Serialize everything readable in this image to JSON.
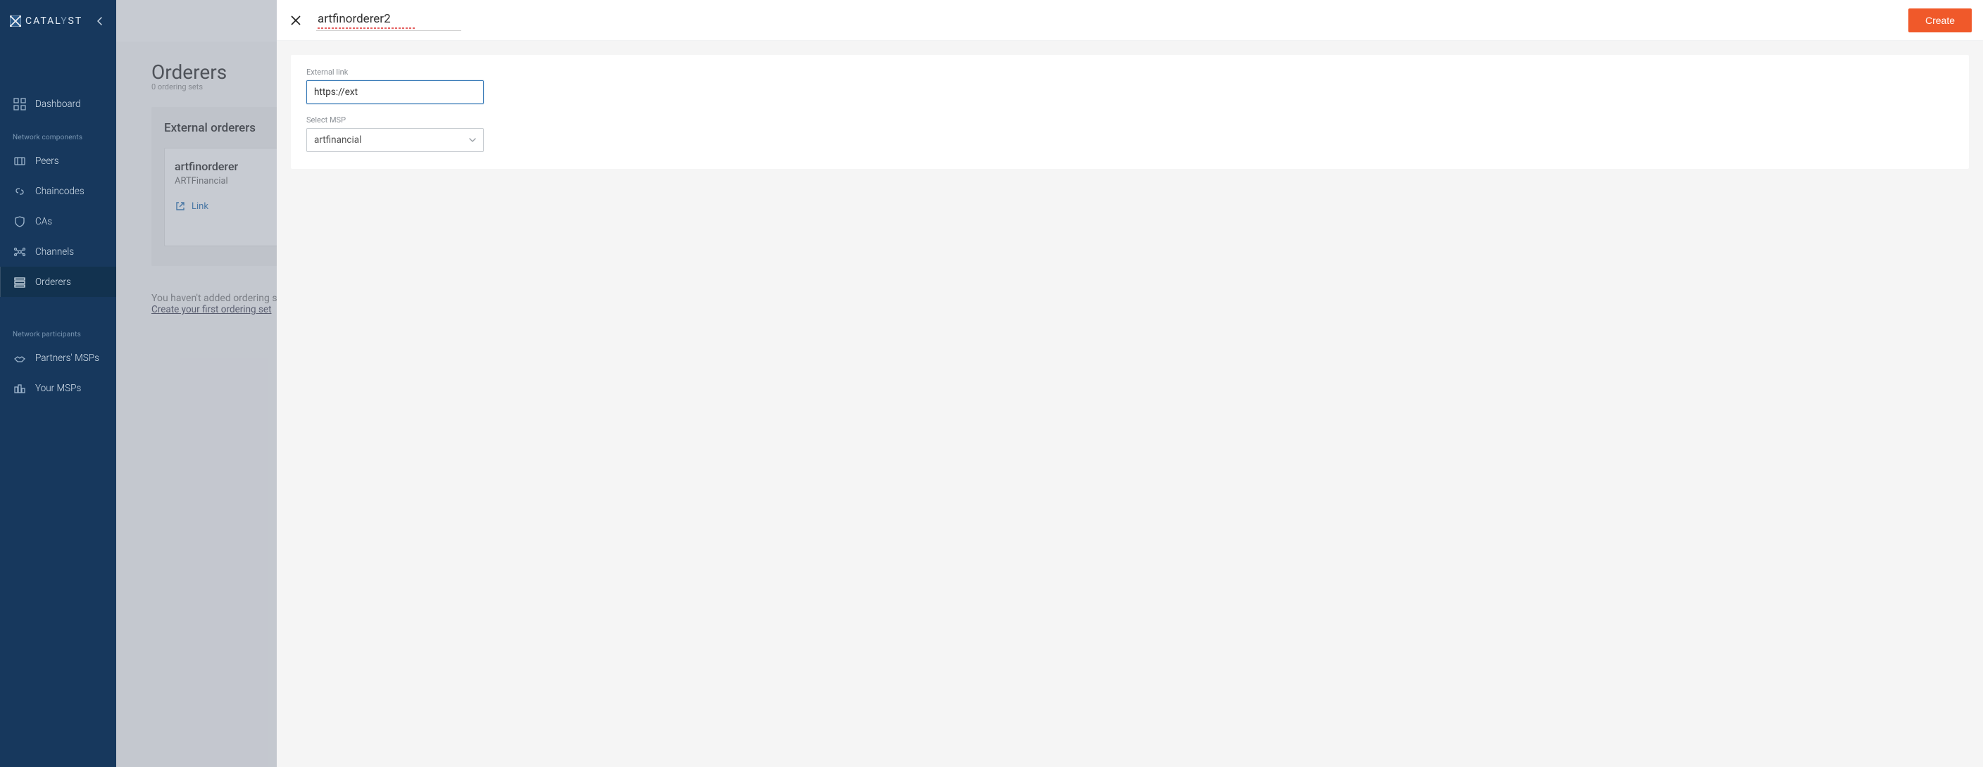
{
  "brand": {
    "name_pre": "CATAL",
    "name_mid": "Y",
    "name_post": "ST"
  },
  "sidebar": {
    "dashboard": "Dashboard",
    "sections": {
      "components": "Network components",
      "participants": "Network participants"
    },
    "items": {
      "peers": "Peers",
      "chaincodes": "Chaincodes",
      "cas": "CAs",
      "channels": "Channels",
      "orderers": "Orderers",
      "partners_msps": "Partners' MSPs",
      "your_msps": "Your MSPs"
    }
  },
  "page": {
    "title": "Orderers",
    "subtitle": "0 ordering sets",
    "external": {
      "title": "External orderers",
      "card": {
        "name": "artfinorderer",
        "org": "ARTFinancial",
        "link": "Link"
      }
    },
    "empty": {
      "text": "You haven't added ordering set",
      "action": "Create your first ordering set"
    }
  },
  "modal": {
    "name_value": "artfinorderer2",
    "create_label": "Create",
    "form": {
      "external_link_label": "External link",
      "external_link_value": "https://ext",
      "msp_label": "Select MSP",
      "msp_value": "artfinancial"
    }
  }
}
